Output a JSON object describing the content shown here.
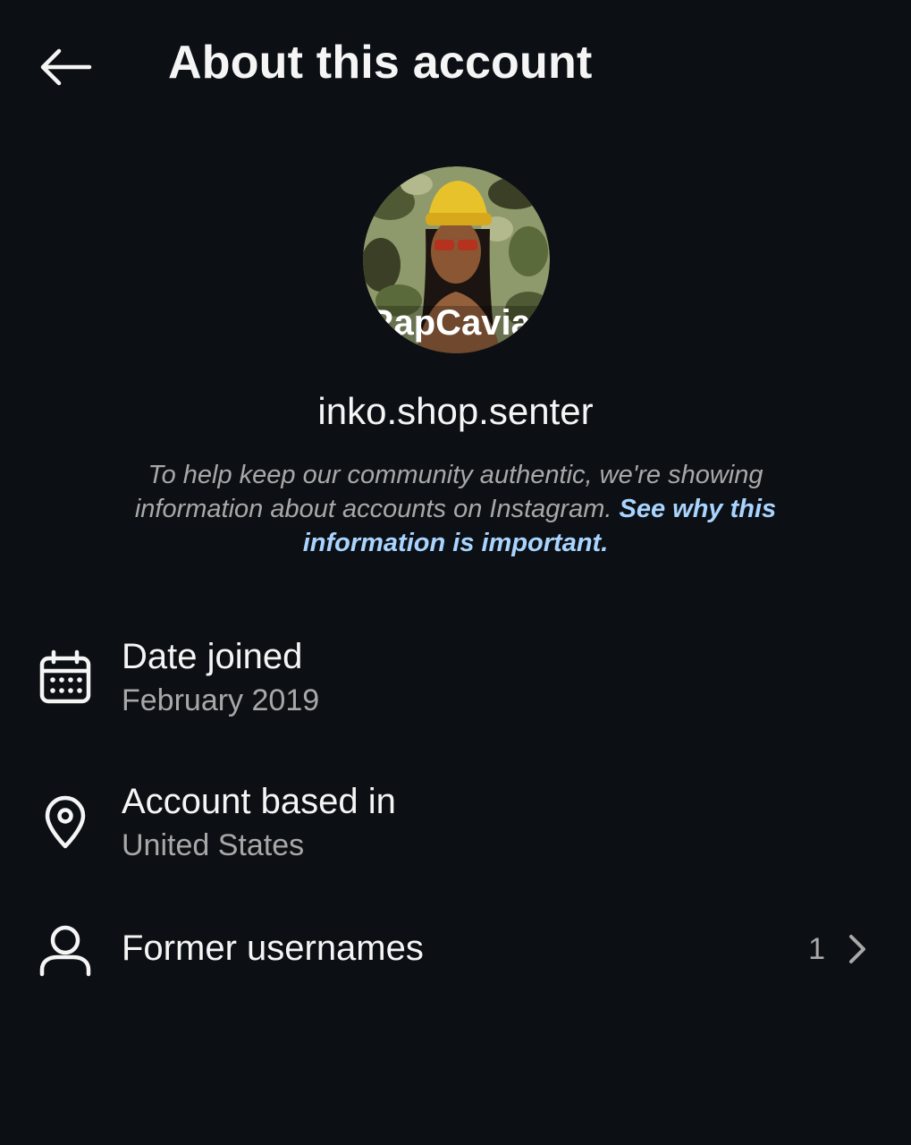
{
  "header": {
    "title": "About this account",
    "back_icon": "arrow-left-icon"
  },
  "profile": {
    "avatar_text": "RapCaviar",
    "username": "inko.shop.senter"
  },
  "notice": {
    "text": "To help keep our community authentic, we're showing information about accounts on Instagram.",
    "link": "See why this information is important."
  },
  "details": {
    "date_joined": {
      "icon": "calendar-icon",
      "label": "Date joined",
      "value": "February 2019"
    },
    "location": {
      "icon": "location-pin-icon",
      "label": "Account based in",
      "value": "United States"
    },
    "former_usernames": {
      "icon": "user-icon",
      "label": "Former usernames",
      "count": "1",
      "chevron_icon": "chevron-right-icon"
    }
  },
  "colors": {
    "background": "#0c1014",
    "text_primary": "#f5f5f5",
    "text_secondary": "#a8a8a8",
    "link": "#a9d4ff"
  }
}
